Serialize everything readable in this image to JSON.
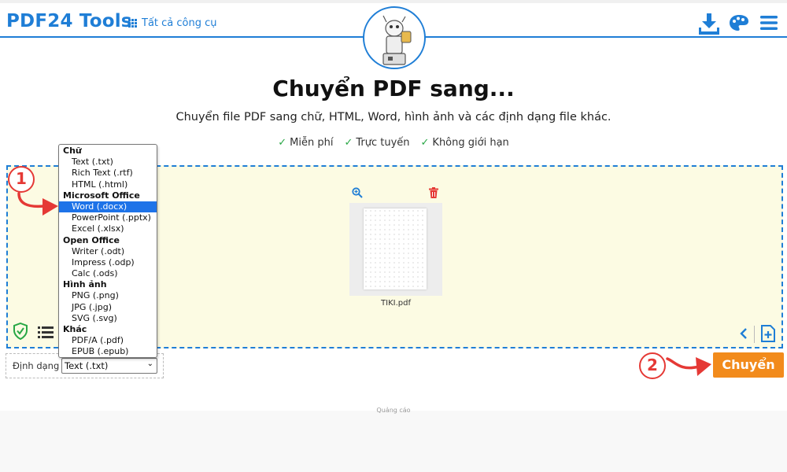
{
  "header": {
    "logo": "PDF24 Tools",
    "all_tools_label": "Tất cả công cụ",
    "icons": [
      "download-icon",
      "palette-icon",
      "menu-icon"
    ]
  },
  "hero": {
    "title": "Chuyển PDF sang...",
    "subtitle": "Chuyển file PDF sang chữ, HTML, Word, hình ảnh và các định dạng file khác.",
    "features": [
      "Miễn phí",
      "Trực tuyến",
      "Không giới hạn"
    ]
  },
  "file": {
    "name": "TIKI.pdf"
  },
  "format": {
    "label": "Định dạng",
    "selected_value": "Text (.txt)",
    "highlighted_option": "Word (.docx)",
    "groups": [
      {
        "label": "Chữ",
        "options": [
          "Text (.txt)",
          "Rich Text (.rtf)",
          "HTML (.html)"
        ]
      },
      {
        "label": "Microsoft Office",
        "options": [
          "Word (.docx)",
          "PowerPoint (.pptx)",
          "Excel (.xlsx)"
        ]
      },
      {
        "label": "Open Office",
        "options": [
          "Writer (.odt)",
          "Impress (.odp)",
          "Calc (.ods)"
        ]
      },
      {
        "label": "Hình ảnh",
        "options": [
          "PNG (.png)",
          "JPG (.jpg)",
          "SVG (.svg)"
        ]
      },
      {
        "label": "Khác",
        "options": [
          "PDF/A (.pdf)",
          "EPUB (.epub)"
        ]
      }
    ]
  },
  "convert_label": "Chuyển",
  "annotations": {
    "step1": "1",
    "step2": "2"
  },
  "ad_label": "Quảng cáo",
  "colors": {
    "brand_blue": "#1f7ed6",
    "convert_orange": "#f28b1c",
    "annotation_red": "#e53935",
    "drop_bg": "#fcfbe3"
  }
}
